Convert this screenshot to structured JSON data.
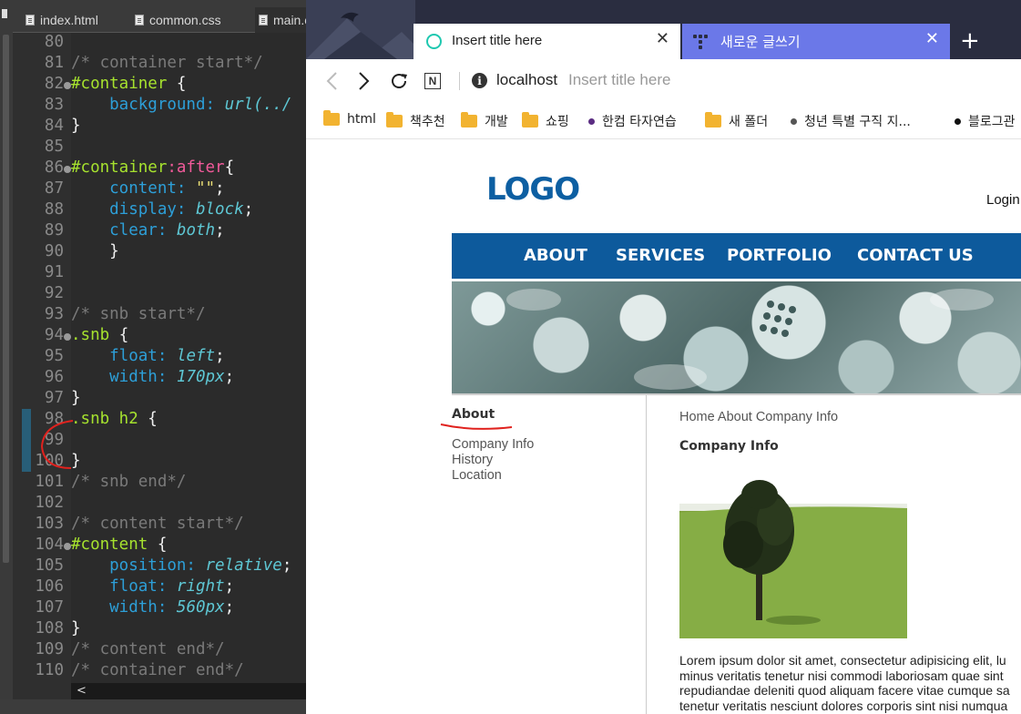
{
  "editor": {
    "tabs": [
      {
        "label": "index.html"
      },
      {
        "label": "common.css"
      },
      {
        "label": "main.c"
      }
    ],
    "line_numbers": [
      "80",
      "81",
      "82",
      "83",
      "84",
      "85",
      "86",
      "87",
      "88",
      "89",
      "90",
      "91",
      "92",
      "93",
      "94",
      "95",
      "96",
      "97",
      "98",
      "99",
      "100",
      "101",
      "102",
      "103",
      "104",
      "105",
      "106",
      "107",
      "108",
      "109",
      "110"
    ],
    "lines": [
      [],
      [
        {
          "t": "/* container start*/",
          "c": "c-cmt"
        }
      ],
      [
        {
          "t": "#container",
          "c": "c-sel"
        },
        {
          "t": " {",
          "c": "c-plain"
        }
      ],
      [
        {
          "t": "    background: ",
          "c": "c-prop"
        },
        {
          "t": "url(../",
          "c": "c-val"
        }
      ],
      [
        {
          "t": "}",
          "c": "c-plain"
        }
      ],
      [],
      [
        {
          "t": "#container",
          "c": "c-sel"
        },
        {
          "t": ":after",
          "c": "c-pseudo"
        },
        {
          "t": "{",
          "c": "c-plain"
        }
      ],
      [
        {
          "t": "    content: ",
          "c": "c-prop"
        },
        {
          "t": "\"\"",
          "c": "c-str"
        },
        {
          "t": ";",
          "c": "c-plain"
        }
      ],
      [
        {
          "t": "    display: ",
          "c": "c-prop"
        },
        {
          "t": "block",
          "c": "c-val"
        },
        {
          "t": ";",
          "c": "c-plain"
        }
      ],
      [
        {
          "t": "    clear: ",
          "c": "c-prop"
        },
        {
          "t": "both",
          "c": "c-val"
        },
        {
          "t": ";",
          "c": "c-plain"
        }
      ],
      [
        {
          "t": "    }",
          "c": "c-plain"
        }
      ],
      [],
      [],
      [
        {
          "t": "/* snb start*/",
          "c": "c-cmt"
        }
      ],
      [
        {
          "t": ".snb",
          "c": "c-sel"
        },
        {
          "t": " {",
          "c": "c-plain"
        }
      ],
      [
        {
          "t": "    float: ",
          "c": "c-prop"
        },
        {
          "t": "left",
          "c": "c-val"
        },
        {
          "t": ";",
          "c": "c-plain"
        }
      ],
      [
        {
          "t": "    width: ",
          "c": "c-prop"
        },
        {
          "t": "170px",
          "c": "c-val"
        },
        {
          "t": ";",
          "c": "c-plain"
        }
      ],
      [
        {
          "t": "}",
          "c": "c-plain"
        }
      ],
      [
        {
          "t": ".snb h2",
          "c": "c-sel"
        },
        {
          "t": " {",
          "c": "c-plain"
        }
      ],
      [],
      [
        {
          "t": "}",
          "c": "c-plain"
        }
      ],
      [
        {
          "t": "/* snb end*/",
          "c": "c-cmt"
        }
      ],
      [],
      [
        {
          "t": "/* content start*/",
          "c": "c-cmt"
        }
      ],
      [
        {
          "t": "#content",
          "c": "c-sel"
        },
        {
          "t": " {",
          "c": "c-plain"
        }
      ],
      [
        {
          "t": "    position: ",
          "c": "c-prop"
        },
        {
          "t": "relative",
          "c": "c-val"
        },
        {
          "t": ";",
          "c": "c-plain"
        }
      ],
      [
        {
          "t": "    float: ",
          "c": "c-prop"
        },
        {
          "t": "right",
          "c": "c-val"
        },
        {
          "t": ";",
          "c": "c-plain"
        }
      ],
      [
        {
          "t": "    width: ",
          "c": "c-prop"
        },
        {
          "t": "560px",
          "c": "c-val"
        },
        {
          "t": ";",
          "c": "c-plain"
        }
      ],
      [
        {
          "t": "}",
          "c": "c-plain"
        }
      ],
      [
        {
          "t": "/* content end*/",
          "c": "c-cmt"
        }
      ],
      [
        {
          "t": "/* container end*/",
          "c": "c-cmt"
        }
      ]
    ],
    "fold_lines": [
      "82",
      "86",
      "94",
      "104"
    ]
  },
  "browser": {
    "tabs": [
      {
        "title": "Insert title here"
      },
      {
        "title": "새로운 글쓰기"
      }
    ],
    "address": {
      "host": "localhost",
      "title": "Insert title here"
    },
    "bookmarks": [
      {
        "label": "html",
        "icon": "folder-icon"
      },
      {
        "label": "책추천",
        "icon": "folder-icon"
      },
      {
        "label": "개발",
        "icon": "folder-icon"
      },
      {
        "label": "쇼핑",
        "icon": "folder-icon"
      },
      {
        "label": "한컴 타자연습",
        "icon": "dot-icon",
        "color": "#5b2d82"
      },
      {
        "label": "새 폴더",
        "icon": "folder-icon"
      },
      {
        "label": "청년 특별 구직 지...",
        "icon": "dot-icon",
        "color": "#555555"
      },
      {
        "label": "블로그관",
        "icon": "dot-icon",
        "color": "#111111"
      }
    ]
  },
  "site": {
    "logo": "LOGO",
    "login": "Login",
    "menu": [
      "ABOUT",
      "SERVICES",
      "PORTFOLIO",
      "CONTACT US"
    ],
    "snb": {
      "title": "About",
      "items": [
        "Company Info",
        "History",
        "Location"
      ]
    },
    "breadcrumb": "Home About Company Info",
    "content_title": "Company Info",
    "paragraph": [
      "Lorem ipsum dolor sit amet, consectetur adipisicing elit, lu",
      "minus veritatis tenetur nisi commodi laboriosam quae sint",
      "repudiandae deleniti quod aliquam facere vitae cumque sa",
      "tenetur veritatis nesciunt dolores corporis sint nisi numqua"
    ]
  },
  "colors": {
    "menu_bar": "#0d5a9c",
    "logo": "#0d5fa2",
    "tab_accent": "#6b78e8",
    "annotation": "#e0221e"
  }
}
